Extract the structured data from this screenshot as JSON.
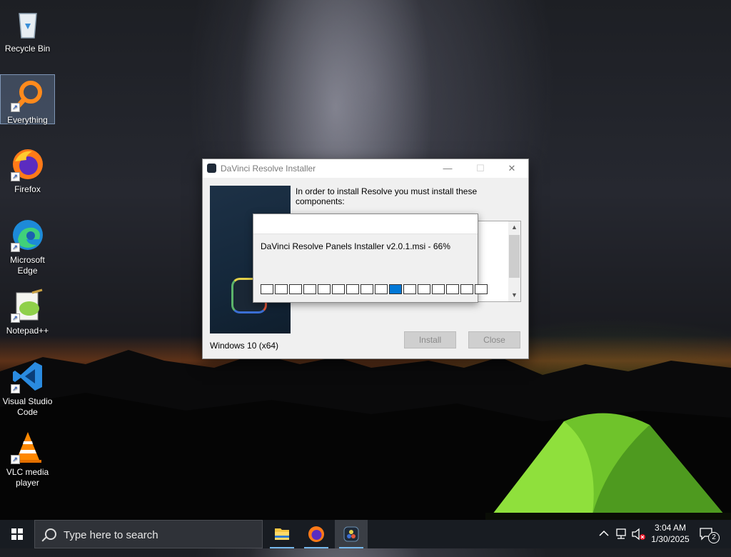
{
  "desktop": {
    "icons": [
      {
        "label": "Recycle Bin",
        "icon": "recycle-bin-icon"
      },
      {
        "label": "Everything",
        "icon": "everything-search-icon",
        "selected": true
      },
      {
        "label": "Firefox",
        "icon": "firefox-icon"
      },
      {
        "label": "Microsoft Edge",
        "icon": "edge-icon"
      },
      {
        "label": "Notepad++",
        "icon": "notepadpp-icon"
      },
      {
        "label": "Visual Studio Code",
        "icon": "vscode-icon"
      },
      {
        "label": "VLC media player",
        "icon": "vlc-icon"
      }
    ]
  },
  "installer": {
    "title": "DaVinci Resolve Installer",
    "intro": "In order to install Resolve you must install these components:",
    "os_label": "Windows 10 (x64)",
    "install_label": "Install",
    "close_label": "Close",
    "minimize_glyph": "—",
    "maximize_glyph": "☐",
    "close_glyph": "✕"
  },
  "progress_popup": {
    "text": "DaVinci Resolve Panels Installer v2.0.1.msi - 66%",
    "segments_total": 16,
    "active_segment": 10
  },
  "taskbar": {
    "search_placeholder": "Type here to search",
    "apps": [
      "file-explorer-icon",
      "firefox-icon",
      "davinci-resolve-icon"
    ],
    "active_app": "davinci-resolve-icon",
    "time": "3:04 AM",
    "date": "1/30/2025",
    "notification_count": "2"
  },
  "colors": {
    "accent": "#0078d7",
    "taskbar": "#181c22"
  }
}
